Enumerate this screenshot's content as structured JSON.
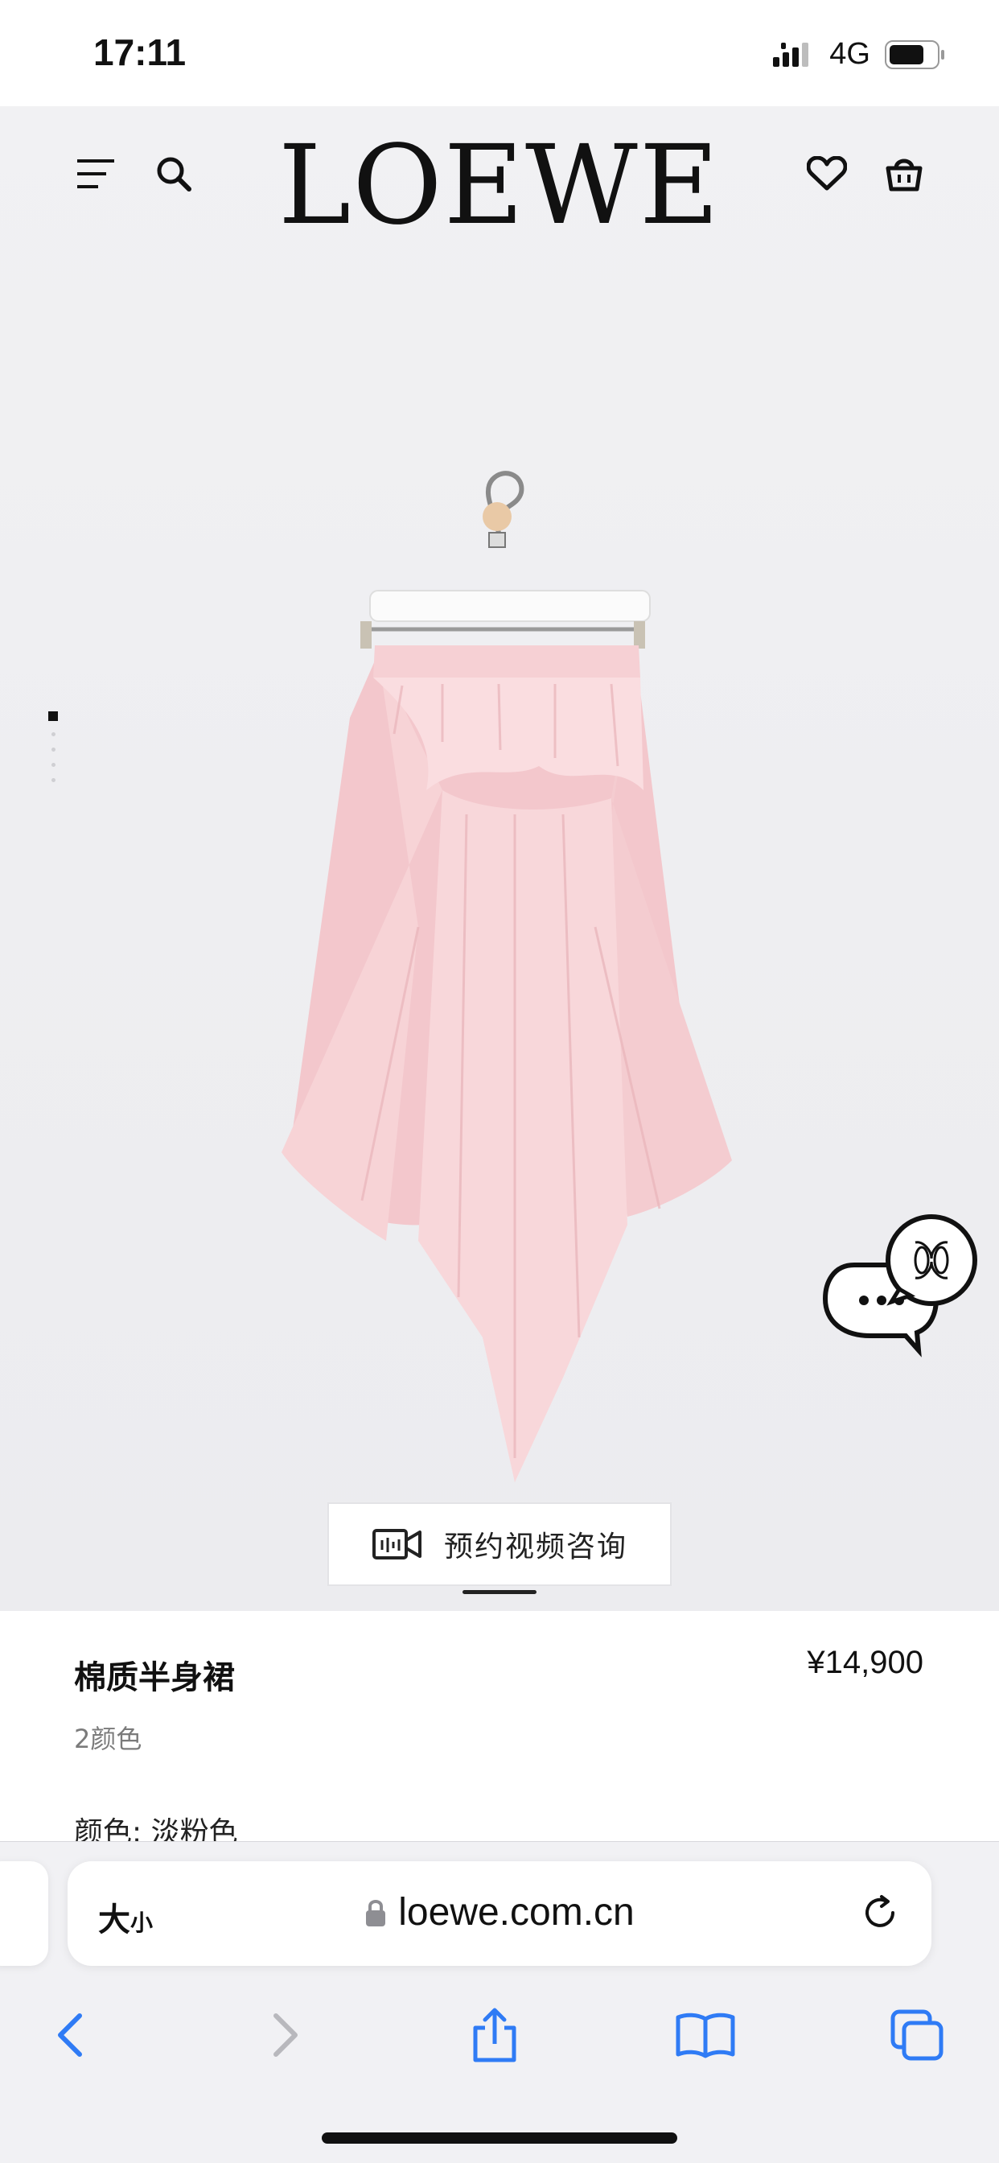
{
  "status_bar": {
    "time": "17:11",
    "network": "4G"
  },
  "header": {
    "brand": "LOEWE"
  },
  "gallery": {
    "page_count": 5,
    "active_index": 0
  },
  "video_consult": {
    "label": "预约视频咨询"
  },
  "product": {
    "name": "棉质半身裙",
    "price": "¥14,900",
    "color_count": "2颜色",
    "color_line": "颜色: 淡粉色"
  },
  "browser": {
    "text_size_big": "大",
    "text_size_small": "小",
    "url": "loewe.com.cn"
  },
  "colors": {
    "accent": "#2f7bf5",
    "skirt": "#f6cfd3",
    "background": "#efeff2"
  },
  "icons": {
    "menu": "menu-icon",
    "search": "search-icon",
    "wishlist": "heart-icon",
    "bag": "shopping-bag-icon",
    "chat": "chat-bubble-icon",
    "video": "video-camera-icon",
    "share": "share-icon",
    "lock": "lock-icon",
    "reload": "reload-icon",
    "back": "chevron-left-icon",
    "forward": "chevron-right-icon",
    "bookmarks": "book-icon",
    "tabs": "tabs-icon"
  }
}
